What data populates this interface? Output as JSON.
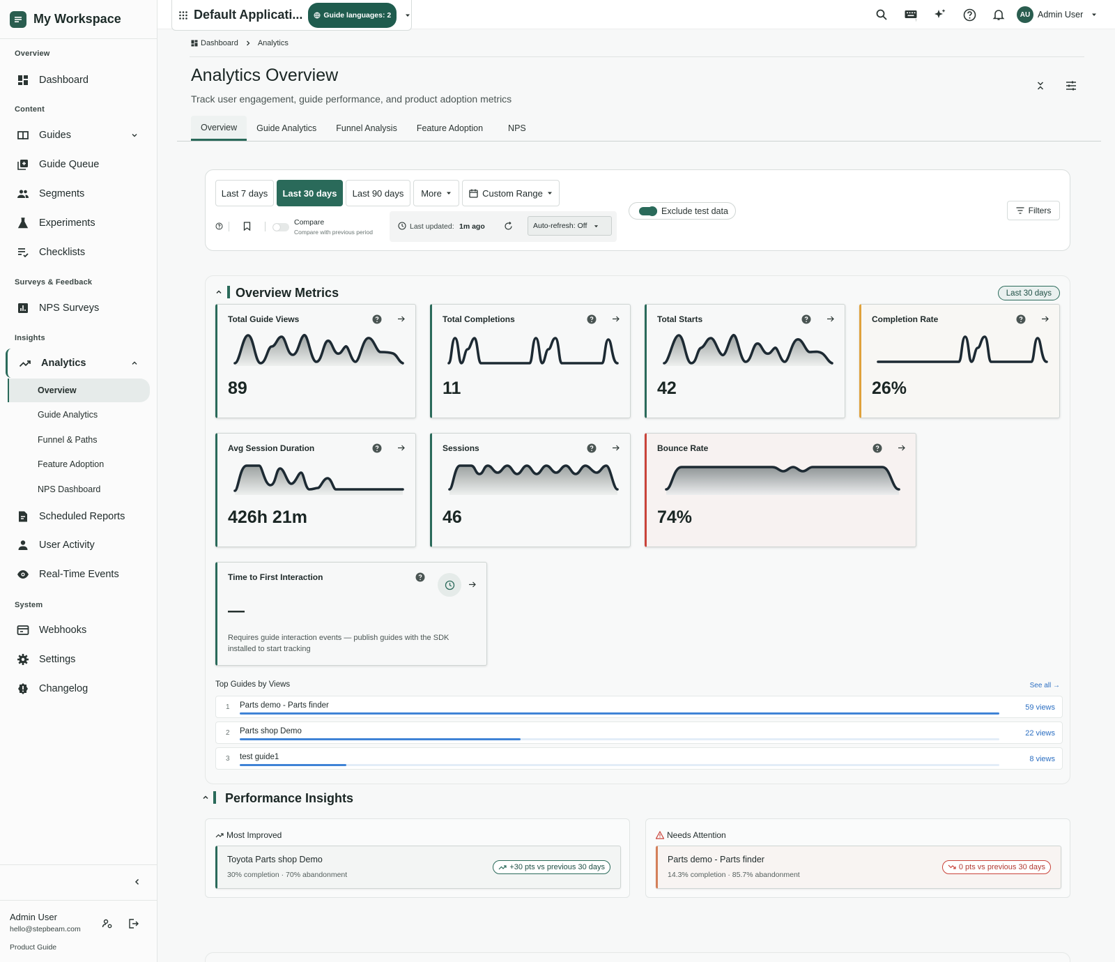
{
  "sidebar": {
    "brand": "My Workspace",
    "sections": {
      "overview": "Overview",
      "content": "Content",
      "surveys": "Surveys & Feedback",
      "insights": "Insights",
      "system": "System"
    },
    "items": {
      "dashboard": "Dashboard",
      "guides": "Guides",
      "guide_queue": "Guide Queue",
      "segments": "Segments",
      "experiments": "Experiments",
      "checklists": "Checklists",
      "nps_surveys": "NPS Surveys",
      "analytics": "Analytics",
      "scheduled_reports": "Scheduled Reports",
      "user_activity": "User Activity",
      "realtime_events": "Real-Time Events",
      "webhooks": "Webhooks",
      "settings": "Settings",
      "changelog": "Changelog"
    },
    "analytics_sub": [
      "Overview",
      "Guide Analytics",
      "Funnel & Paths",
      "Feature Adoption",
      "NPS Dashboard"
    ],
    "user": {
      "name": "Admin User",
      "email": "hello@stepbeam.com",
      "product_guide": "Product Guide"
    }
  },
  "topbar": {
    "app_name": "Default Applicati...",
    "lang_pill": "Guide languages: 2",
    "avatar_initials": "AU",
    "user_name": "Admin User"
  },
  "breadcrumb": {
    "home": "Dashboard",
    "current": "Analytics"
  },
  "page": {
    "title": "Analytics Overview",
    "subtitle": "Track user engagement, guide performance, and product adoption metrics"
  },
  "tabs": [
    "Overview",
    "Guide Analytics",
    "Funnel Analysis",
    "Feature Adoption",
    "NPS"
  ],
  "filters": {
    "range_buttons": [
      "Last 7 days",
      "Last 30 days",
      "Last 90 days"
    ],
    "selected_range": "Last 30 days",
    "more": "More",
    "custom_range": "Custom Range",
    "exclude_test": "Exclude test data",
    "exclude_test_on": true,
    "filters_btn": "Filters",
    "compare_title": "Compare",
    "compare_sub": "Compare with previous period",
    "last_updated_label": "Last updated:",
    "last_updated_value": "1m ago",
    "auto_refresh": "Auto-refresh: Off"
  },
  "metrics_section": {
    "title": "Overview Metrics",
    "badge": "Last 30 days",
    "cards": [
      {
        "title": "Total Guide Views",
        "value": "89",
        "accent": "#2a6a5a"
      },
      {
        "title": "Total Completions",
        "value": "11",
        "accent": "#2a6a5a"
      },
      {
        "title": "Total Starts",
        "value": "42",
        "accent": "#2a6a5a"
      },
      {
        "title": "Completion Rate",
        "value": "26%",
        "accent": "#e0a23c"
      },
      {
        "title": "Avg Session Duration",
        "value": "426h 21m",
        "accent": "#2a6a5a"
      },
      {
        "title": "Sessions",
        "value": "46",
        "accent": "#2a6a5a"
      },
      {
        "title": "Bounce Rate",
        "value": "74%",
        "accent": "#c9433a"
      }
    ],
    "ttfi": {
      "title": "Time to First Interaction",
      "value": "—",
      "note": "Requires guide interaction events — publish guides with the SDK installed to start tracking"
    },
    "top_guides": {
      "title": "Top Guides by Views",
      "see_all": "See all →",
      "rows": [
        {
          "rank": "1",
          "name": "Parts demo - Parts finder",
          "views": "59 views",
          "share": 1.0
        },
        {
          "rank": "2",
          "name": "Parts shop Demo",
          "views": "22 views",
          "share": 0.37
        },
        {
          "rank": "3",
          "name": "test guide1",
          "views": "8 views",
          "share": 0.14
        }
      ]
    }
  },
  "insights": {
    "title": "Performance Insights",
    "improved": {
      "heading": "Most Improved",
      "name": "Toyota Parts shop Demo",
      "stats": "30% completion · 70% abandonment",
      "pill": "+30 pts vs previous 30 days"
    },
    "attention": {
      "heading": "Needs Attention",
      "name": "Parts demo - Parts finder",
      "stats": "14.3% completion · 85.7% abandonment",
      "pill": "0 pts vs previous 30 days"
    }
  },
  "colors": {
    "accent": "#2a6a5a",
    "warn": "#e0a23c",
    "danger": "#c9433a",
    "link": "#2c6fc2"
  }
}
